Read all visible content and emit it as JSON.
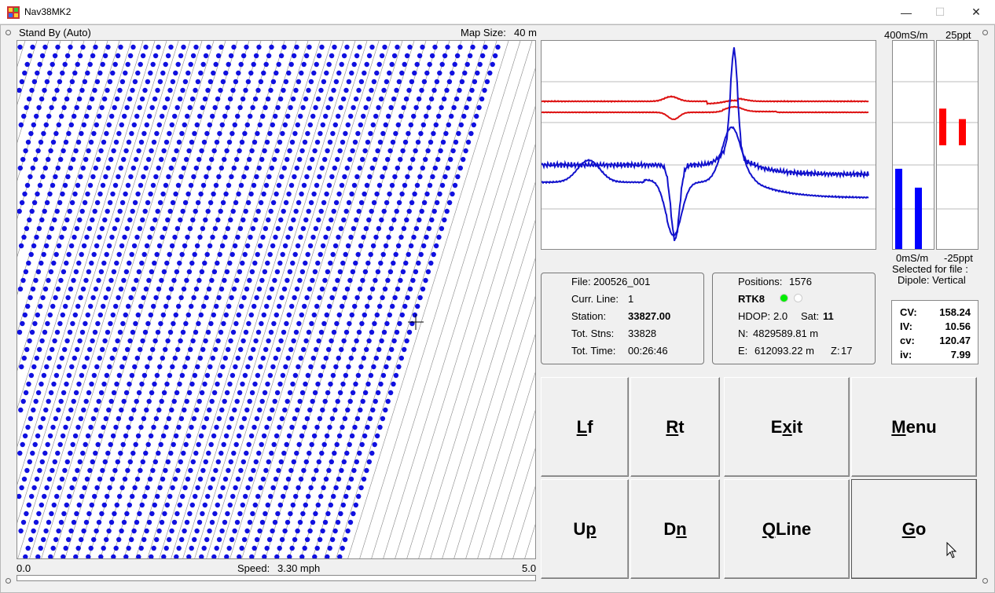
{
  "window": {
    "title": "Nav38MK2",
    "minimize": "—",
    "maximize": "☐",
    "close": "✕"
  },
  "status": {
    "mode": "Stand By (Auto)",
    "map_size_label": "Map Size:",
    "map_size_value": "40 m"
  },
  "speed": {
    "min": "0.0",
    "max": "5.0",
    "label": "Speed:",
    "value": "3.30 mph",
    "level": 0.66
  },
  "meters": {
    "cond_top": "400mS/m",
    "cond_bottom": "0mS/m",
    "inph_top": "25ppt",
    "inph_bottom": "-25ppt",
    "cond_bars": [
      0.39,
      0.3
    ],
    "inph_bars": [
      0.35,
      0.25
    ],
    "selected_label": "Selected for file :",
    "dipole_label": "Dipole: Vertical"
  },
  "file_info": {
    "file_label": "File:",
    "file_value": "200526_001",
    "line_label": "Curr. Line:",
    "line_value": "1",
    "station_label": "Station:",
    "station_value": "33827.00",
    "tot_stns_label": "Tot. Stns:",
    "tot_stns_value": "33828",
    "tot_time_label": "Tot. Time:",
    "tot_time_value": "00:26:46"
  },
  "gps_info": {
    "positions_label": "Positions:",
    "positions_value": "1576",
    "fix": "RTK8",
    "hdop_label": "HDOP:",
    "hdop_value": "2.0",
    "sat_label": "Sat:",
    "sat_value": "11",
    "n_label": "N:",
    "n_value": "4829589.81 m",
    "e_label": "E:",
    "e_value": "612093.22 m",
    "z_label": "Z:",
    "z_value": "17",
    "indicator_colors": [
      "#00ee00",
      "#ffffff"
    ]
  },
  "readout": {
    "cv_label": "CV:",
    "cv_value": "158.24",
    "iv_label": "IV:",
    "iv_value": "10.56",
    "cv2_label": "cv:",
    "cv2_value": "120.47",
    "iv2_label": "iv:",
    "iv2_value": "7.99"
  },
  "buttons": {
    "lf_u": "L",
    "lf": "f",
    "rt_u": "R",
    "rt": "t",
    "exit_a": "E",
    "exit_u": "x",
    "exit_b": "it",
    "menu_u": "M",
    "menu": "enu",
    "up_a": "U",
    "up_u": "p",
    "dn_a": "D",
    "dn_u": "n",
    "qline_u": "Q",
    "qline": "Line",
    "go_u": "G",
    "go": "o"
  },
  "colors": {
    "dot": "#1010e0",
    "red_trace": "#dd1111",
    "blue_trace": "#1111cc",
    "cond_bar": "#0000ff",
    "inph_bar": "#ff0000"
  }
}
